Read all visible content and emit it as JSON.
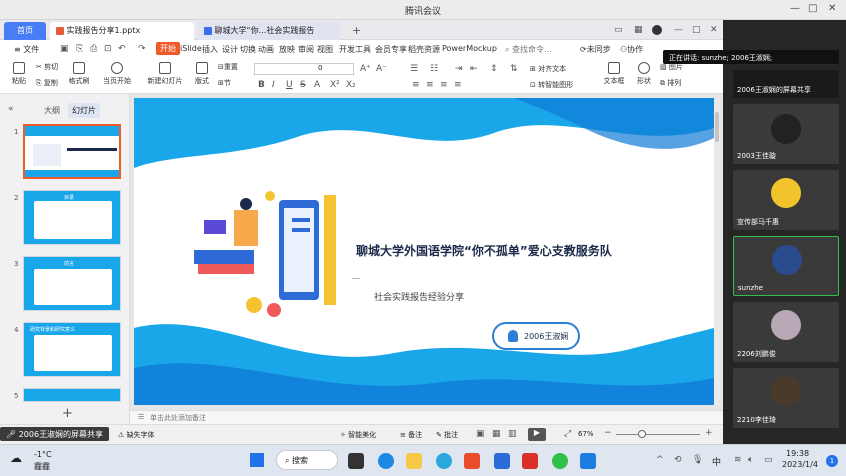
{
  "meeting": {
    "title": "腾讯会议",
    "minimize": "—",
    "maximize": "□",
    "close": "✕"
  },
  "wps": {
    "tabs": {
      "home": "首页",
      "file1": "实践报告分享1.pptx",
      "file2": "聊城大学“你...社会实践报告"
    },
    "menu": {
      "file": "文件",
      "start": "开始",
      "islide": "iSlide",
      "insert": "插入",
      "design": "设计",
      "switch": "切换",
      "animate": "动画",
      "play": "放映",
      "review": "审阅",
      "view": "视图",
      "dev": "开发工具",
      "vip": "会员专享",
      "daoke": "稻壳资源",
      "powermockup": "PowerMockup",
      "search": "查找命令...",
      "unsynced": "未同步",
      "collab": "协作"
    },
    "ribbon": {
      "paste": "粘贴",
      "cut": "剪切",
      "copy": "复制",
      "format_painter": "格式刷",
      "from_current": "当页开始",
      "new_slide": "新建幻灯片",
      "layout": "版式",
      "section": "节",
      "reset": "重置",
      "font_size": "0",
      "text_box": "文本框",
      "shape": "形状",
      "arrange": "排列",
      "align_text": "对齐文本",
      "convert_smartart": "转智能图形",
      "picture": "图片"
    },
    "panel_tabs": {
      "outline": "大纲",
      "slides": "幻灯片"
    },
    "slide_numbers": [
      "1",
      "2",
      "3",
      "4",
      "5"
    ],
    "thumb_texts": {
      "t2": "目录",
      "t3": "前言",
      "t4": "研究背景和研究意义"
    },
    "add_slide": "+",
    "notes_placeholder": "单击此处添加备注",
    "status": {
      "sharing": "2006王淑娴的屏幕共享",
      "missing_font": "缺失字体",
      "beautify": "智能美化",
      "notes": "备注",
      "comments": "批注",
      "zoom": "67%"
    }
  },
  "slide": {
    "title": "聊城大学外国语学院“你不孤单”爱心支教服务队",
    "subtitle": "社会实践报告经验分享",
    "presenter": "2006王淑娴",
    "colors": {
      "wave": "#1aa7ea",
      "title": "#1b2a4a",
      "button_border": "#2c7fd6"
    }
  },
  "participants": {
    "speaking": "正在讲话: sunzhe; 2006王淑娴;",
    "tiles": [
      "2006王淑娴的屏幕共享",
      "2003王佳璇",
      "宣传部马千惠",
      "sunzhe",
      "2206刘鹏俊",
      "2210李佳琦"
    ]
  },
  "taskbar": {
    "weather_temp": "-1°C",
    "weather_desc": "霾霾",
    "search": "搜索",
    "ime": "中",
    "time": "19:38",
    "date": "2023/1/4",
    "notif": "1"
  }
}
